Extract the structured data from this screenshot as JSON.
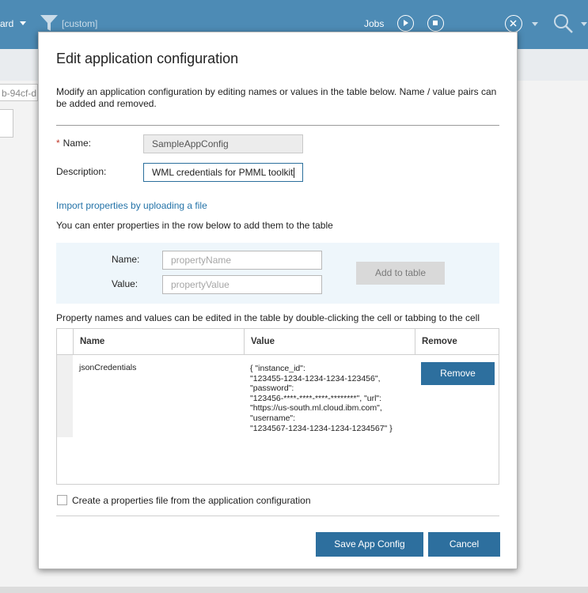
{
  "background": {
    "dashboard_fragment": "ard",
    "filter_label": "[custom]",
    "jobs_label": "Jobs",
    "id_fragment": "b-94cf-d"
  },
  "dialog": {
    "title": "Edit application configuration",
    "intro": "Modify an application configuration by editing names or values in the table below. Name / value pairs can be added and removed.",
    "required_mark": "*",
    "name_label": "Name:",
    "name_value": "SampleAppConfig",
    "description_label": "Description:",
    "description_value": "WML credentials for PMML toolkit",
    "import_link": "Import properties by uploading a file",
    "add_hint": "You can enter properties in the row below to add them to the table",
    "entry": {
      "name_label": "Name:",
      "name_placeholder": "propertyName",
      "value_label": "Value:",
      "value_placeholder": "propertyValue",
      "add_button": "Add to table"
    },
    "table_hint": "Property names and values can be edited in the table by double-clicking the cell or tabbing to the cell",
    "table": {
      "columns": [
        "Name",
        "Value",
        "Remove"
      ],
      "rows": [
        {
          "name": "jsonCredentials",
          "value_lines": [
            "{ \"instance_id\":",
            "\"123455-1234-1234-1234-123456\",",
            "\"password\":",
            "\"123456-****-****-****-********\", \"url\":",
            "\"https://us-south.ml.cloud.ibm.com\",",
            "\"username\":",
            "\"1234567-1234-1234-1234-1234567\" }"
          ],
          "remove_label": "Remove"
        }
      ]
    },
    "checkbox_label": "Create a properties file from the application configuration",
    "checkbox_checked": false,
    "save_button": "Save App Config",
    "cancel_button": "Cancel"
  },
  "colors": {
    "header_blue": "#4d8bb5",
    "primary_button": "#2d6f9e",
    "link": "#2473a8",
    "panel_bg": "#eef6fb"
  },
  "icons": [
    "filter-icon",
    "play-icon",
    "stop-icon",
    "close-circle-icon",
    "search-icon",
    "chevron-down-icon"
  ]
}
